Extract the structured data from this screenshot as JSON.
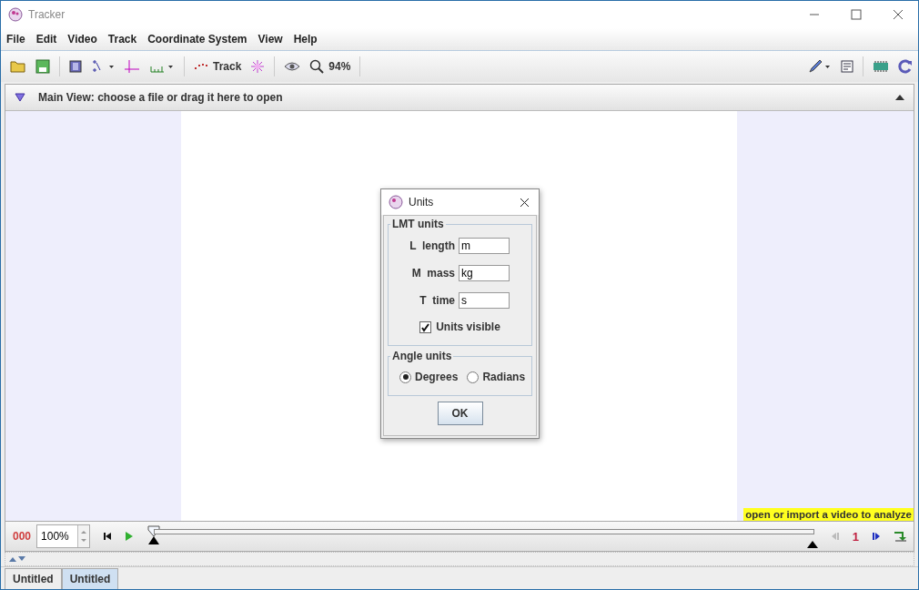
{
  "window": {
    "title": "Tracker"
  },
  "menu": [
    "File",
    "Edit",
    "Video",
    "Track",
    "Coordinate System",
    "View",
    "Help"
  ],
  "toolbar": {
    "track_label": "Track",
    "zoom": "94%"
  },
  "main_view": {
    "title": "Main View: choose a file or drag it here to open",
    "hint": "open or import a video to analyze"
  },
  "player": {
    "frame": "000",
    "rate": "100%",
    "step": "1"
  },
  "tabs": [
    {
      "label": "Untitled",
      "selected": false
    },
    {
      "label": "Untitled",
      "selected": true
    }
  ],
  "dialog": {
    "title": "Units",
    "lmt_group": "LMT units",
    "fields": [
      {
        "label": "L  length",
        "value": "m"
      },
      {
        "label": "M  mass",
        "value": "kg"
      },
      {
        "label": "T  time",
        "value": "s"
      }
    ],
    "units_visible": {
      "label": "Units visible",
      "checked": true
    },
    "angle_group": "Angle units",
    "angle_options": [
      {
        "label": "Degrees",
        "selected": true
      },
      {
        "label": "Radians",
        "selected": false
      }
    ],
    "ok": "OK"
  }
}
